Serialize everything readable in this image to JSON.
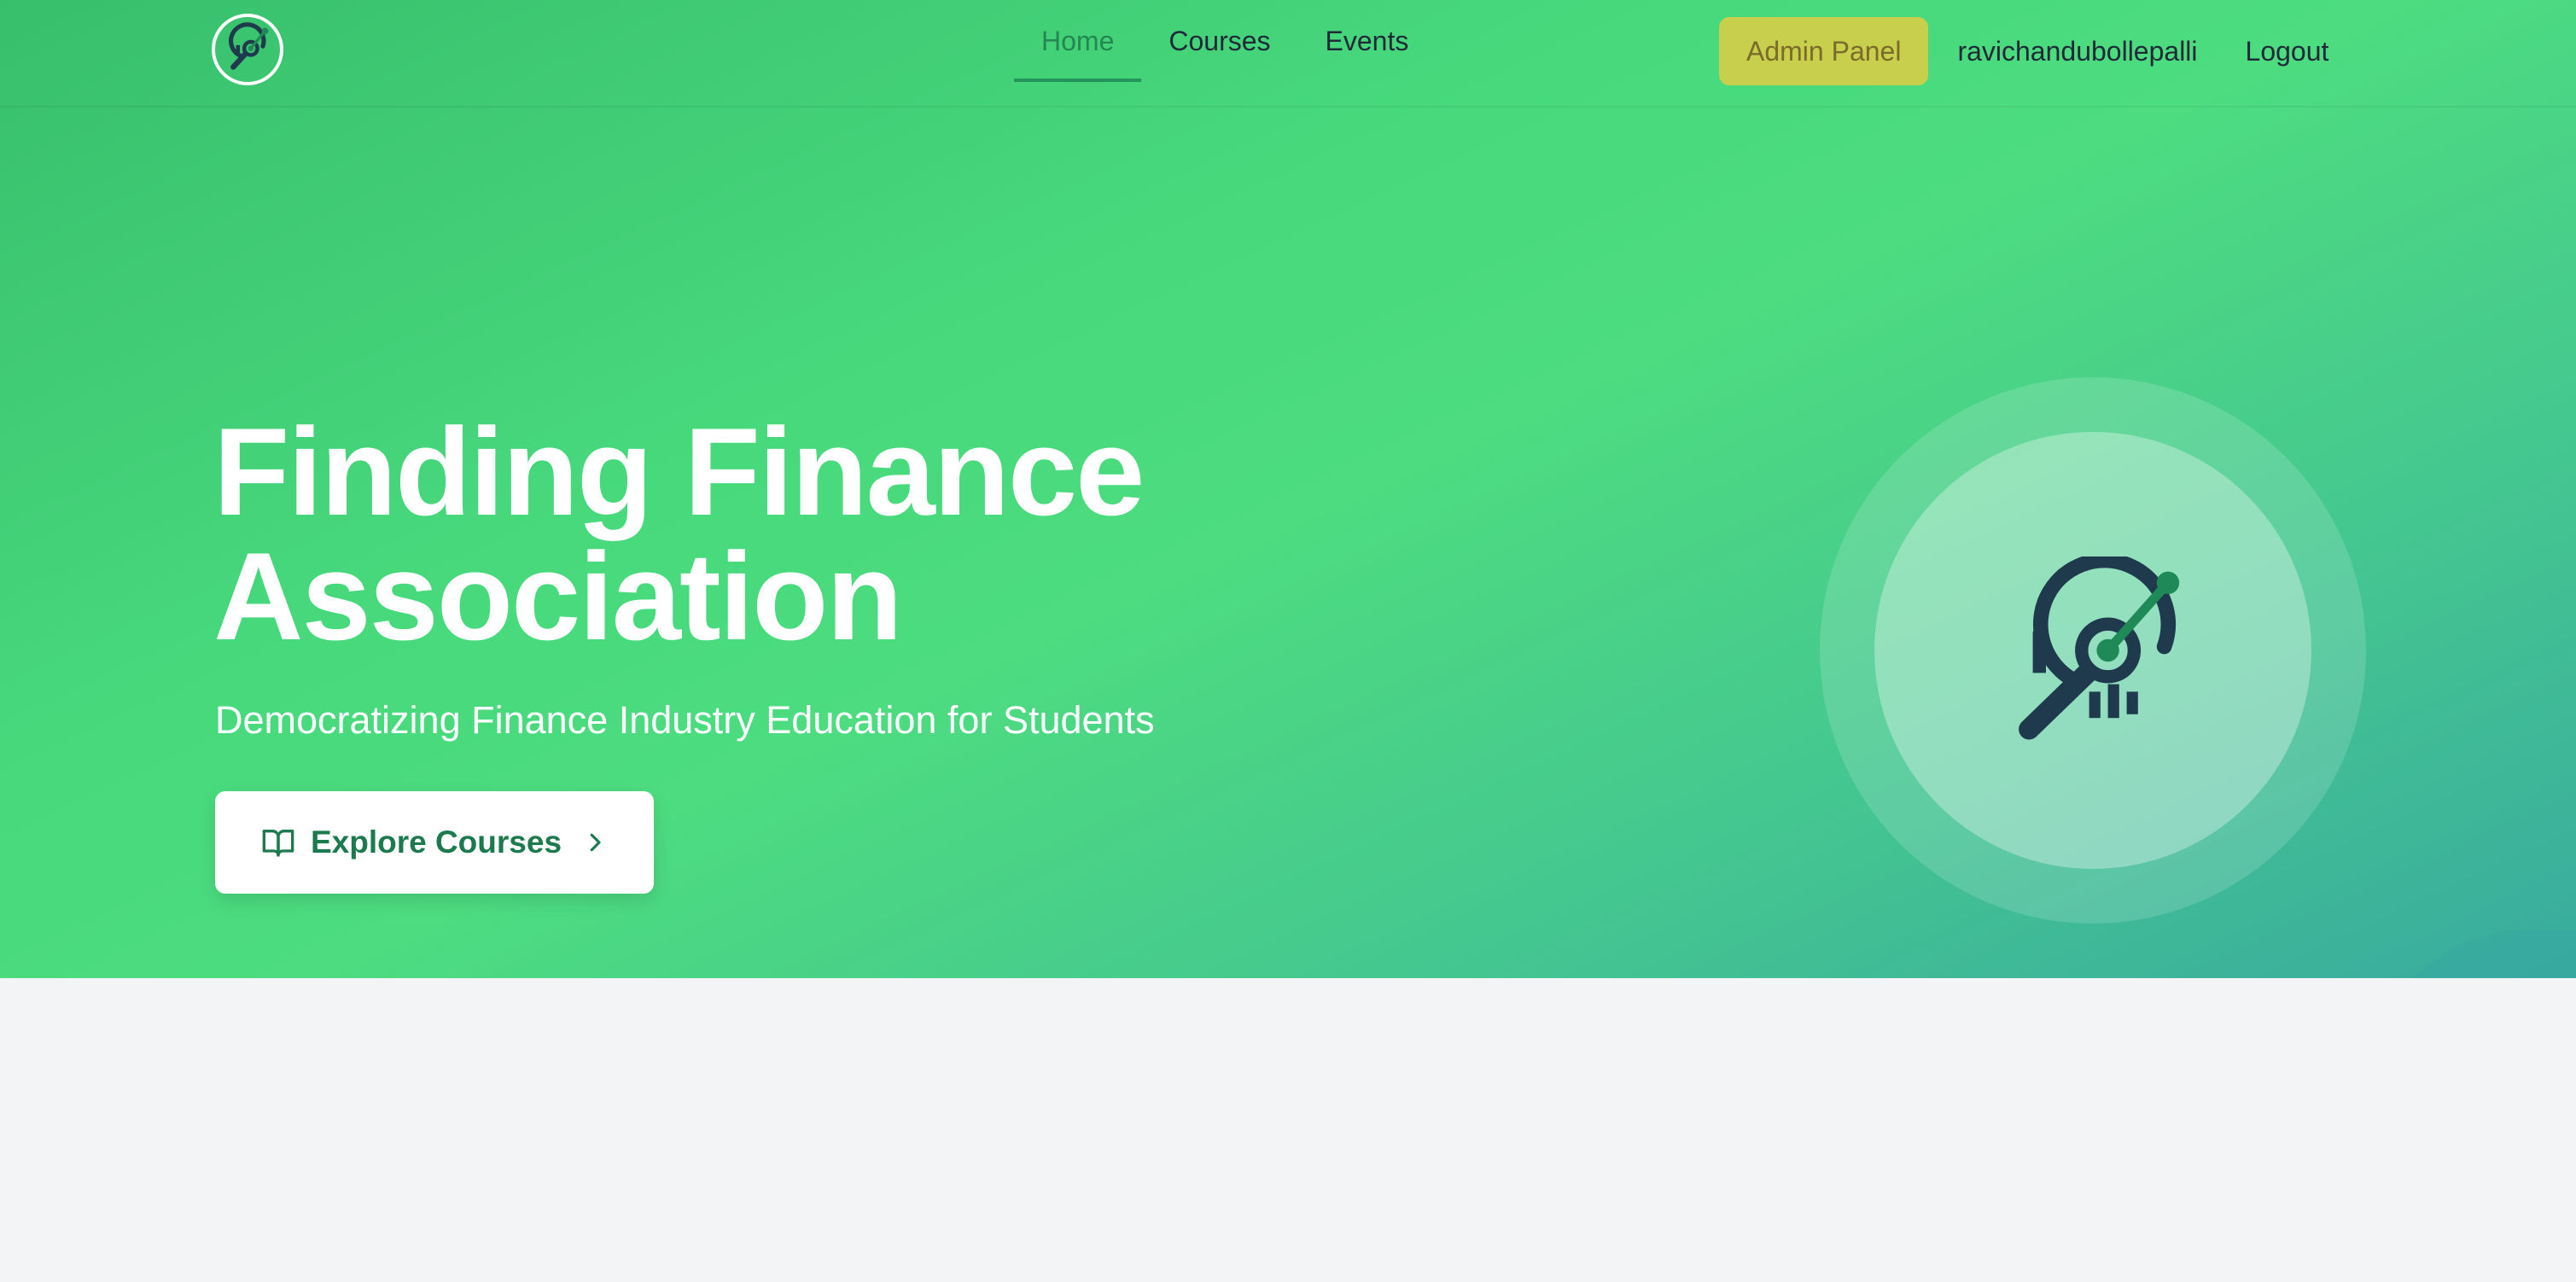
{
  "nav": {
    "logo_icon": "finance-search-logo",
    "links": [
      {
        "label": "Home",
        "active": true
      },
      {
        "label": "Courses",
        "active": false
      },
      {
        "label": "Events",
        "active": false
      }
    ],
    "admin_label": "Admin Panel",
    "username": "ravichandubollepalli",
    "logout_label": "Logout"
  },
  "hero": {
    "title_line1": "Finding Finance",
    "title_line2": "Association",
    "subtitle": "Democratizing Finance Industry Education for Students",
    "cta_label": "Explore Courses",
    "cta_icon": "book-open-icon",
    "cta_arrow": "chevron-right-icon",
    "badge_icon": "finance-search-logo"
  },
  "colors": {
    "hero_gradient_start": "#38bf6c",
    "hero_gradient_mid": "#4ddc80",
    "hero_gradient_end": "#38a8a0",
    "admin_button": "#c8cf4c",
    "cta_text": "#1d7a4e",
    "logo_dark": "#1e3a4c",
    "page_background": "#f3f4f6"
  }
}
